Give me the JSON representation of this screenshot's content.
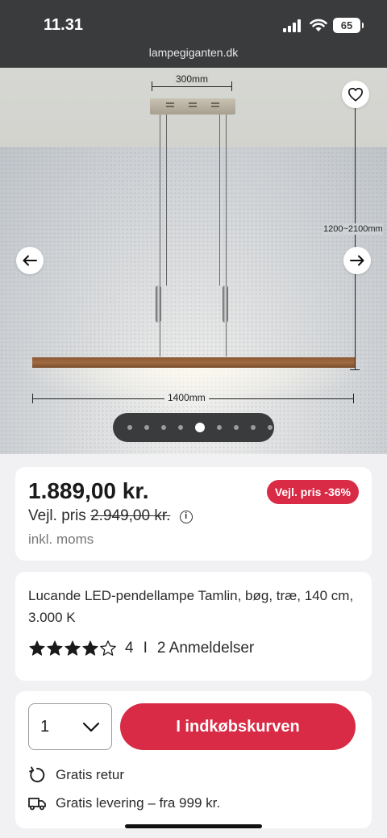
{
  "status_bar": {
    "time": "11.31",
    "battery": "65",
    "url": "lampegiganten.dk"
  },
  "gallery": {
    "dim_width_top": "300mm",
    "dim_height": "1200~2100mm",
    "dim_width_bottom": "1400mm",
    "slide_count": 9,
    "active_slide": 4,
    "icons": {
      "favorite": "heart-icon",
      "prev": "arrow-left-icon",
      "next": "arrow-right-icon"
    }
  },
  "price": {
    "current": "1.889,00 kr.",
    "badge": "Vejl. pris -36%",
    "rrp_label": "Vejl. pris",
    "rrp_value": "2.949,00 kr.",
    "vat_note": "inkl. moms"
  },
  "product": {
    "title": "Lucande LED-pendellampe Tamlin, bøg, træ, 140 cm, 3.000 K",
    "rating": 4,
    "rating_max": 5,
    "rating_text": "4",
    "separator": "I",
    "reviews": "2 Anmeldelser"
  },
  "purchase": {
    "quantity": "1",
    "add_to_cart": "I indkøbskurven",
    "perks": [
      {
        "icon": "return-arrow-icon",
        "label": "Gratis retur"
      },
      {
        "icon": "truck-icon",
        "label": "Gratis levering – fra 999 kr."
      }
    ]
  },
  "colors": {
    "accent": "#d92b45",
    "statusbar": "#3a3b3d",
    "background": "#f1f1f3"
  }
}
